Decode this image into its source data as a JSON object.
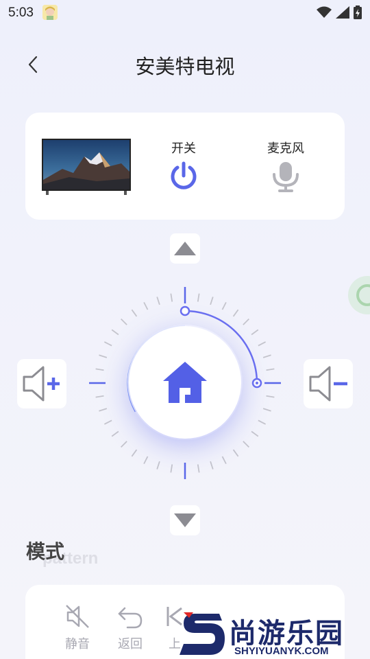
{
  "status_bar": {
    "time": "5:03"
  },
  "header": {
    "title": "安美特电视"
  },
  "device_card": {
    "power_label": "开关",
    "mic_label": "麦克风"
  },
  "mode_section": {
    "title": "模式",
    "subtitle": "pattern",
    "items": [
      {
        "label": "静音"
      },
      {
        "label": "返回"
      },
      {
        "label": "上"
      }
    ]
  },
  "watermark": {
    "brand": "尚游乐园",
    "url": "SHYIYUANYK.COM"
  },
  "colors": {
    "accent": "#5a67e8",
    "mic_gray": "#b4b4ba",
    "label_gray": "#a8a8b2"
  }
}
